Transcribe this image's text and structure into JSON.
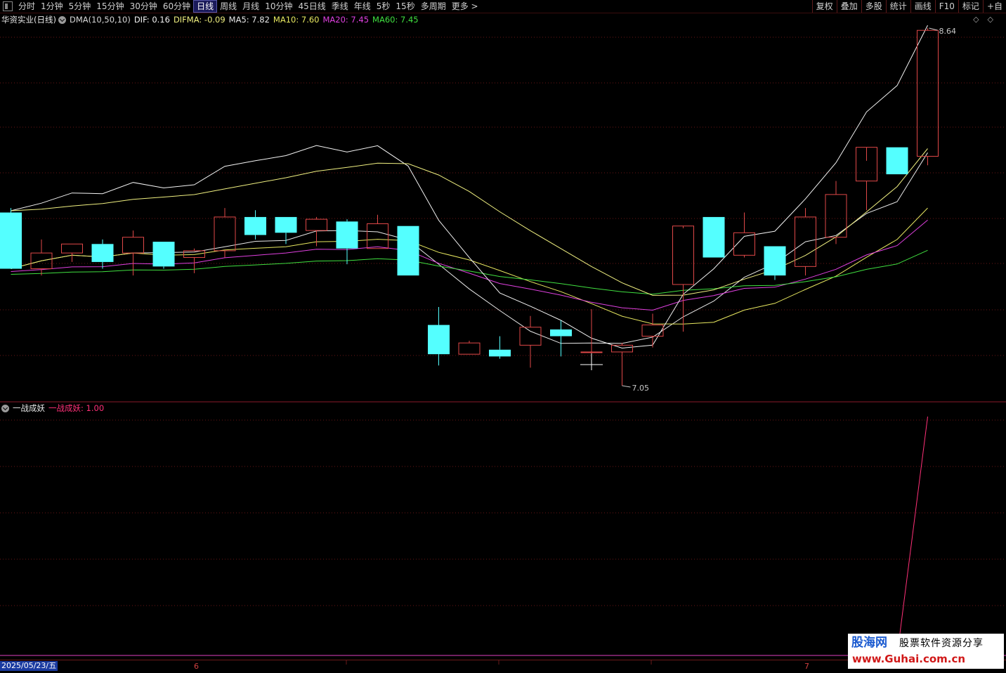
{
  "toolbar": {
    "tabs": [
      "分时",
      "1分钟",
      "5分钟",
      "15分钟",
      "30分钟",
      "60分钟",
      "日线",
      "周线",
      "月线",
      "10分钟",
      "45日线",
      "季线",
      "年线",
      "5秒",
      "15秒",
      "多周期",
      "更多 >"
    ],
    "active_tab": "日线",
    "right_buttons": [
      "复权",
      "叠加",
      "多股",
      "统计",
      "画线",
      "F10",
      "标记",
      "+自"
    ]
  },
  "main_panel": {
    "title": "华资实业(日线)",
    "indicator_name": "DMA(10,50,10)",
    "dif": "DIF: 0.16",
    "difma": "DIFMA: -0.09",
    "ma5": "MA5: 7.82",
    "ma10": "MA10: 7.60",
    "ma20": "MA20: 7.45",
    "ma60": "MA60: 7.45",
    "high_marker": "8.64",
    "low_marker": "7.05",
    "colors": {
      "up": "#e04848",
      "down": "#54ffff",
      "ma5": "#e8e8e8",
      "ma10": "#e8e860",
      "ma20": "#e040e0",
      "ma60": "#40e040",
      "dif": "#f4f4f4",
      "difma": "#f0f080"
    }
  },
  "sub_panel": {
    "indicator_title": "一战成妖",
    "value_label": "一战成妖: 1.00",
    "color": "#ff3078"
  },
  "date_axis": {
    "start_date": "2025/05/23/五",
    "ticks": [
      "6",
      "7"
    ]
  },
  "watermark": {
    "title": "股海网",
    "subtitle": "股票软件资源分享",
    "url": "www.Guhai.com.cn"
  },
  "chart_data": {
    "type": "candlestick",
    "price_range": [
      6.95,
      8.7
    ],
    "candles": [
      {
        "o": 7.82,
        "h": 7.84,
        "l": 7.57,
        "c": 7.57
      },
      {
        "o": 7.57,
        "h": 7.7,
        "l": 7.54,
        "c": 7.64
      },
      {
        "o": 7.64,
        "h": 7.68,
        "l": 7.6,
        "c": 7.68
      },
      {
        "o": 7.68,
        "h": 7.7,
        "l": 7.57,
        "c": 7.6
      },
      {
        "o": 7.64,
        "h": 7.74,
        "l": 7.54,
        "c": 7.71
      },
      {
        "o": 7.69,
        "h": 7.69,
        "l": 7.57,
        "c": 7.58
      },
      {
        "o": 7.62,
        "h": 7.66,
        "l": 7.55,
        "c": 7.65
      },
      {
        "o": 7.65,
        "h": 7.84,
        "l": 7.62,
        "c": 7.8
      },
      {
        "o": 7.8,
        "h": 7.83,
        "l": 7.7,
        "c": 7.72
      },
      {
        "o": 7.8,
        "h": 7.8,
        "l": 7.68,
        "c": 7.73
      },
      {
        "o": 7.74,
        "h": 7.8,
        "l": 7.67,
        "c": 7.79
      },
      {
        "o": 7.78,
        "h": 7.79,
        "l": 7.59,
        "c": 7.66
      },
      {
        "o": 7.66,
        "h": 7.81,
        "l": 7.66,
        "c": 7.77
      },
      {
        "o": 7.76,
        "h": 7.76,
        "l": 7.54,
        "c": 7.54
      },
      {
        "o": 7.32,
        "h": 7.4,
        "l": 7.14,
        "c": 7.19
      },
      {
        "o": 7.19,
        "h": 7.25,
        "l": 7.19,
        "c": 7.24
      },
      {
        "o": 7.21,
        "h": 7.27,
        "l": 7.17,
        "c": 7.18
      },
      {
        "o": 7.23,
        "h": 7.36,
        "l": 7.13,
        "c": 7.31
      },
      {
        "o": 7.3,
        "h": 7.34,
        "l": 7.18,
        "c": 7.27
      },
      {
        "o": 7.2,
        "h": 7.39,
        "l": 7.18,
        "c": 7.2
      },
      {
        "o": 7.2,
        "h": 7.24,
        "l": 7.05,
        "c": 7.23
      },
      {
        "o": 7.27,
        "h": 7.37,
        "l": 7.22,
        "c": 7.32
      },
      {
        "o": 7.5,
        "h": 7.75,
        "l": 7.29,
        "c": 7.76
      },
      {
        "o": 7.8,
        "h": 7.8,
        "l": 7.62,
        "c": 7.62
      },
      {
        "o": 7.63,
        "h": 7.82,
        "l": 7.62,
        "c": 7.73
      },
      {
        "o": 7.67,
        "h": 7.67,
        "l": 7.52,
        "c": 7.54
      },
      {
        "o": 7.58,
        "h": 7.84,
        "l": 7.54,
        "c": 7.8
      },
      {
        "o": 7.71,
        "h": 7.96,
        "l": 7.68,
        "c": 7.9
      },
      {
        "o": 7.96,
        "h": 8.05,
        "l": 7.83,
        "c": 8.11
      },
      {
        "o": 8.11,
        "h": 8.11,
        "l": 7.99,
        "c": 7.99
      },
      {
        "o": 8.07,
        "h": 8.64,
        "l": 8.03,
        "c": 8.63
      }
    ]
  }
}
